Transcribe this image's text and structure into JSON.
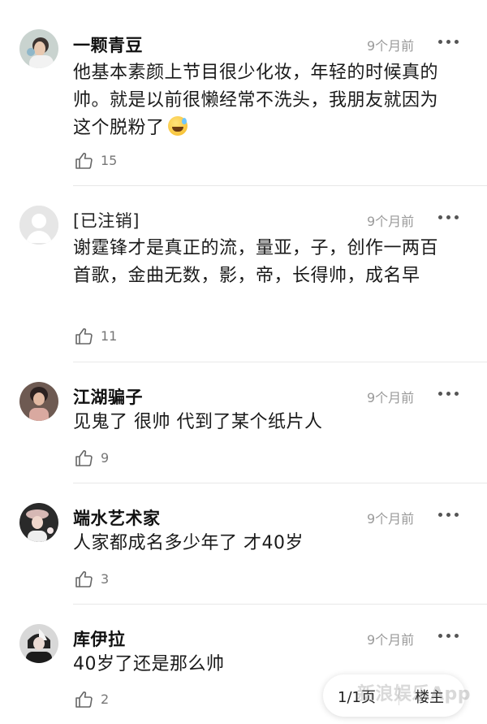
{
  "comments": [
    {
      "username": "一颗青豆",
      "time": "9个月前",
      "content": "他基本素颜上节目很少化妆，年轻的时候真的帅。就是以前很懒经常不洗头，我朋友就因为这个脱粉了",
      "emoji": "grinning-sweat-emoji",
      "likes": "15",
      "avatar": "photo-avatar"
    },
    {
      "username": "[已注销]",
      "time": "9个月前",
      "content": "谢霆锋才是真正的流，量亚，子，创作一两百首歌，金曲无数，影，帝，长得帅，成名早",
      "likes": "11",
      "avatar": "default-avatar"
    },
    {
      "username": "江湖骗子",
      "time": "9个月前",
      "content": "见鬼了 很帅 代到了某个纸片人",
      "likes": "9",
      "avatar": "photo-avatar"
    },
    {
      "username": "端水艺术家",
      "time": "9个月前",
      "content": "人家都成名多少年了 才40岁",
      "likes": "3",
      "avatar": "photo-avatar"
    },
    {
      "username": "库伊拉",
      "time": "9个月前",
      "content": "40岁了还是那么帅",
      "likes": "2",
      "avatar": "photo-avatar"
    }
  ],
  "pager": {
    "page": "1/1页",
    "floor_host": "楼主"
  },
  "watermark": "新浪娱乐App",
  "colors": {
    "time": "#9a9a9a",
    "text": "#1a1a1a",
    "divider": "#e8e8e8"
  }
}
